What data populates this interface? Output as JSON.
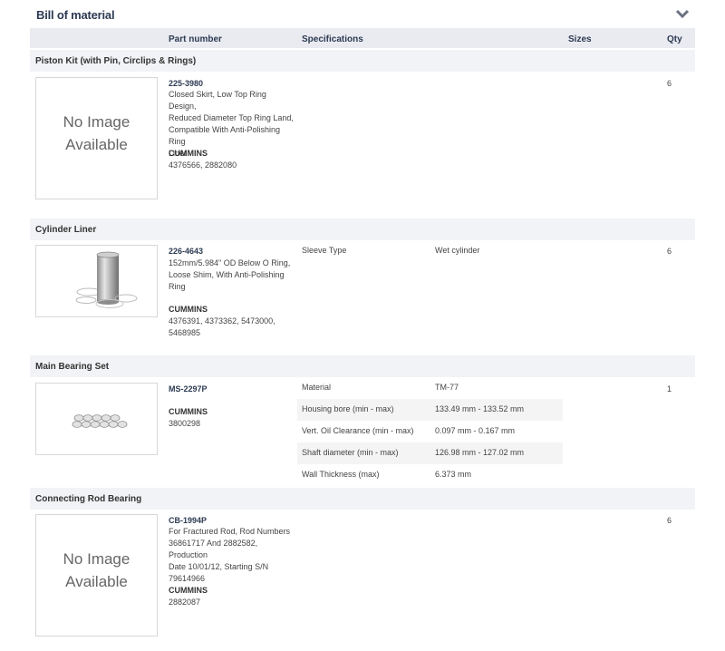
{
  "panel": {
    "title": "Bill of material"
  },
  "columns": {
    "part_number": "Part number",
    "specifications": "Specifications",
    "sizes": "Sizes",
    "qty": "Qty"
  },
  "no_image": {
    "line1": "No Image",
    "line2": "Available"
  },
  "items": [
    {
      "section": "Piston Kit (with Pin, Circlips & Rings)",
      "part_number": "225-3980",
      "description_lines": [
        "Closed Skirt, Low Top Ring Design,",
        "Reduced Diameter Top Ring Land,",
        "Compatible With Anti-Polishing Ring",
        "Liner"
      ],
      "brand": "CUMMINS",
      "oem_lines": [
        "4376566, 2882080"
      ],
      "qty": "6"
    },
    {
      "section": "Cylinder Liner",
      "part_number": "226-4643",
      "description_lines": [
        "152mm/5.984\" OD Below O Ring,",
        "Loose Shim, With Anti-Polishing",
        "Ring"
      ],
      "brand": "CUMMINS",
      "oem_lines": [
        "4376391, 4373362, 5473000,",
        "5468985"
      ],
      "qty": "6",
      "specs": [
        {
          "label": "Sleeve Type",
          "value": "Wet cylinder"
        }
      ]
    },
    {
      "section": "Main Bearing Set",
      "part_number": "MS-2297P",
      "brand": "CUMMINS",
      "oem_lines": [
        "3800298"
      ],
      "qty": "1",
      "specs": [
        {
          "label": "Material",
          "value": "TM-77"
        },
        {
          "label": "Housing bore (min - max)",
          "value": "133.49 mm - 133.52 mm"
        },
        {
          "label": "Vert. Oil Clearance (min - max)",
          "value": "0.097 mm - 0.167 mm"
        },
        {
          "label": "Shaft diameter (min - max)",
          "value": "126.98 mm - 127.02 mm"
        },
        {
          "label": "Wall Thickness (max)",
          "value": "6.373 mm"
        }
      ]
    },
    {
      "section": "Connecting Rod Bearing",
      "part_number": "CB-1994P",
      "description_lines": [
        "For Fractured Rod, Rod Numbers",
        "36861717 And 2882582, Production",
        "Date 10/01/12, Starting S/N",
        "79614966"
      ],
      "brand": "CUMMINS",
      "oem_lines": [
        "2882087"
      ],
      "qty": "6"
    }
  ]
}
